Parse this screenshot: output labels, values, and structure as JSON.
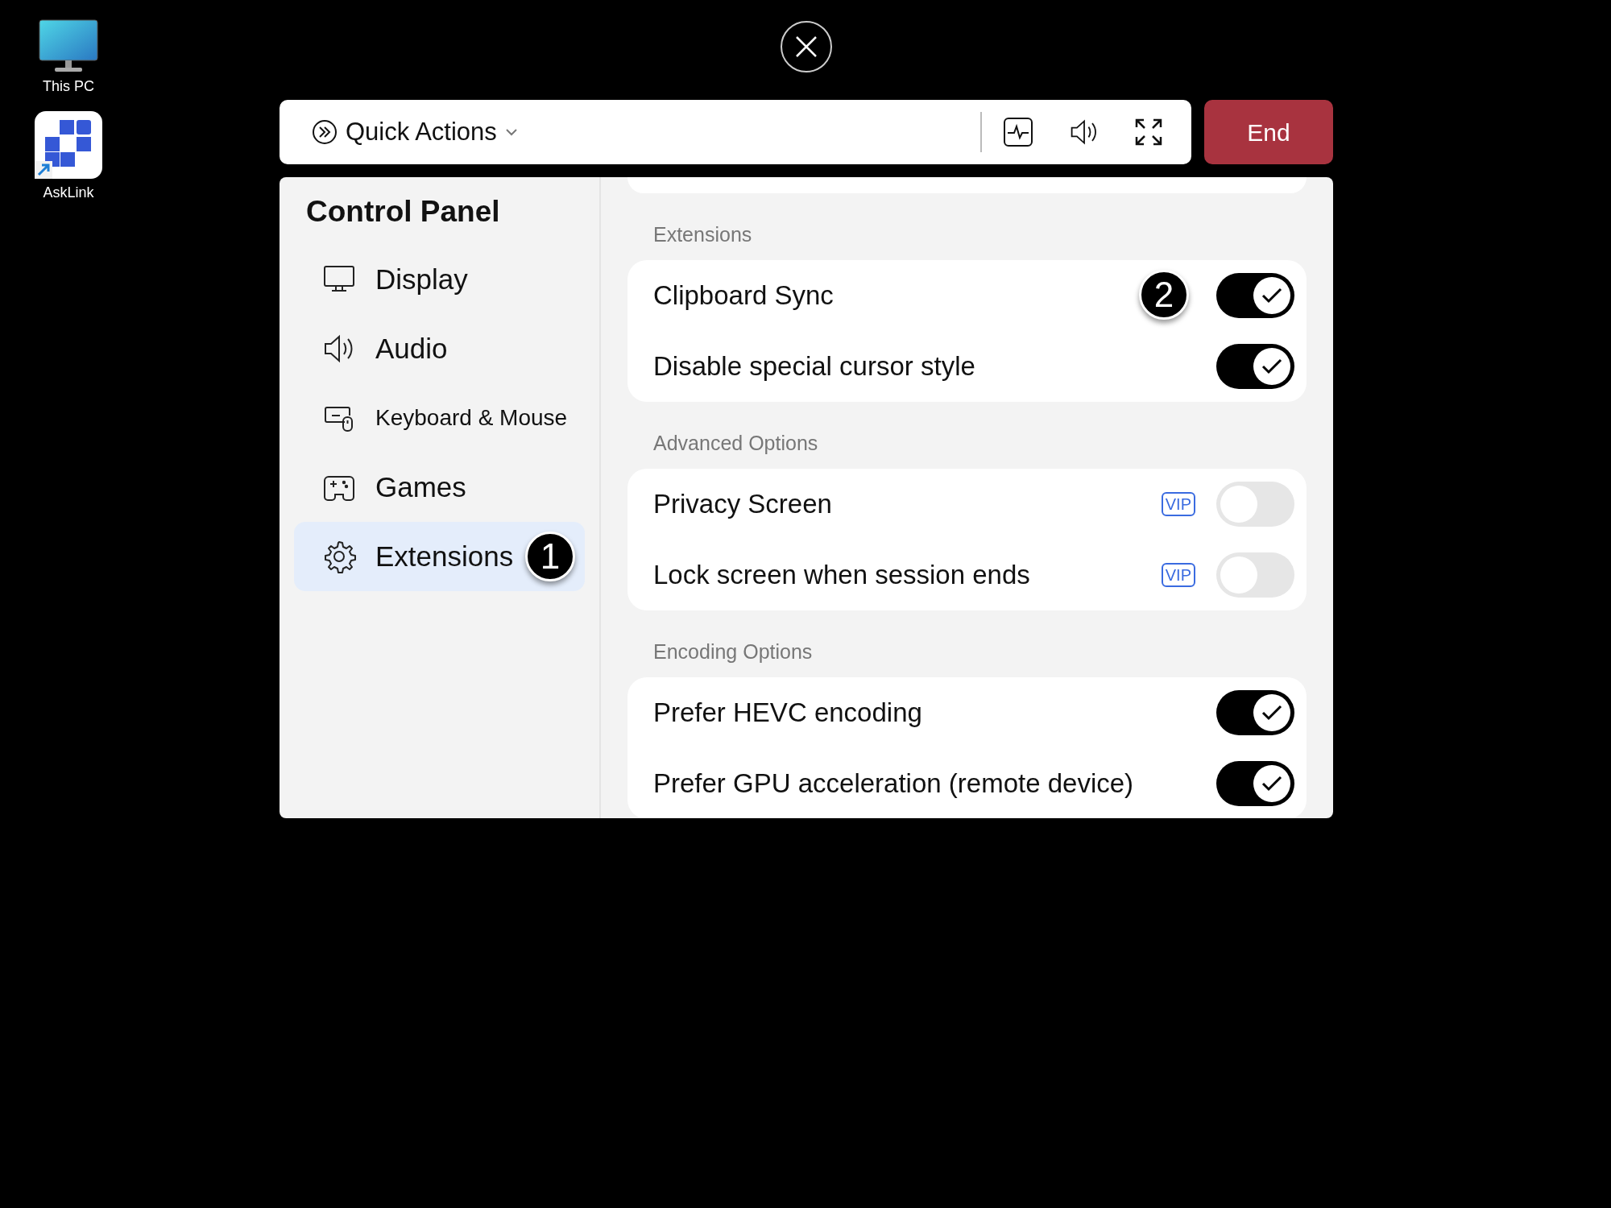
{
  "desktop_icons": [
    {
      "label": "This PC",
      "kind": "monitor"
    },
    {
      "label": "AskLink",
      "kind": "app"
    }
  ],
  "toolbar": {
    "quick_actions": "Quick Actions",
    "end_button": "End"
  },
  "sidebar": {
    "title": "Control Panel",
    "items": [
      {
        "label": "Display",
        "kind": "display",
        "selected": false
      },
      {
        "label": "Audio",
        "kind": "audio",
        "selected": false
      },
      {
        "label": "Keyboard & Mouse",
        "kind": "keyboard",
        "selected": false
      },
      {
        "label": "Games",
        "kind": "games",
        "selected": false
      },
      {
        "label": "Extensions",
        "kind": "gear",
        "selected": true,
        "callout": "1"
      }
    ]
  },
  "sections": [
    {
      "heading": "Extensions",
      "settings": [
        {
          "label": "Clipboard Sync",
          "on": true,
          "callout": "2"
        },
        {
          "label": "Disable special cursor style",
          "on": true
        }
      ]
    },
    {
      "heading": "Advanced Options",
      "settings": [
        {
          "label": "Privacy Screen",
          "on": false,
          "badge": "VIP"
        },
        {
          "label": "Lock screen when session ends",
          "on": false,
          "badge": "VIP"
        }
      ]
    },
    {
      "heading": "Encoding Options",
      "settings": [
        {
          "label": "Prefer HEVC encoding",
          "on": true
        },
        {
          "label": "Prefer GPU acceleration (remote device)",
          "on": true
        }
      ]
    }
  ]
}
